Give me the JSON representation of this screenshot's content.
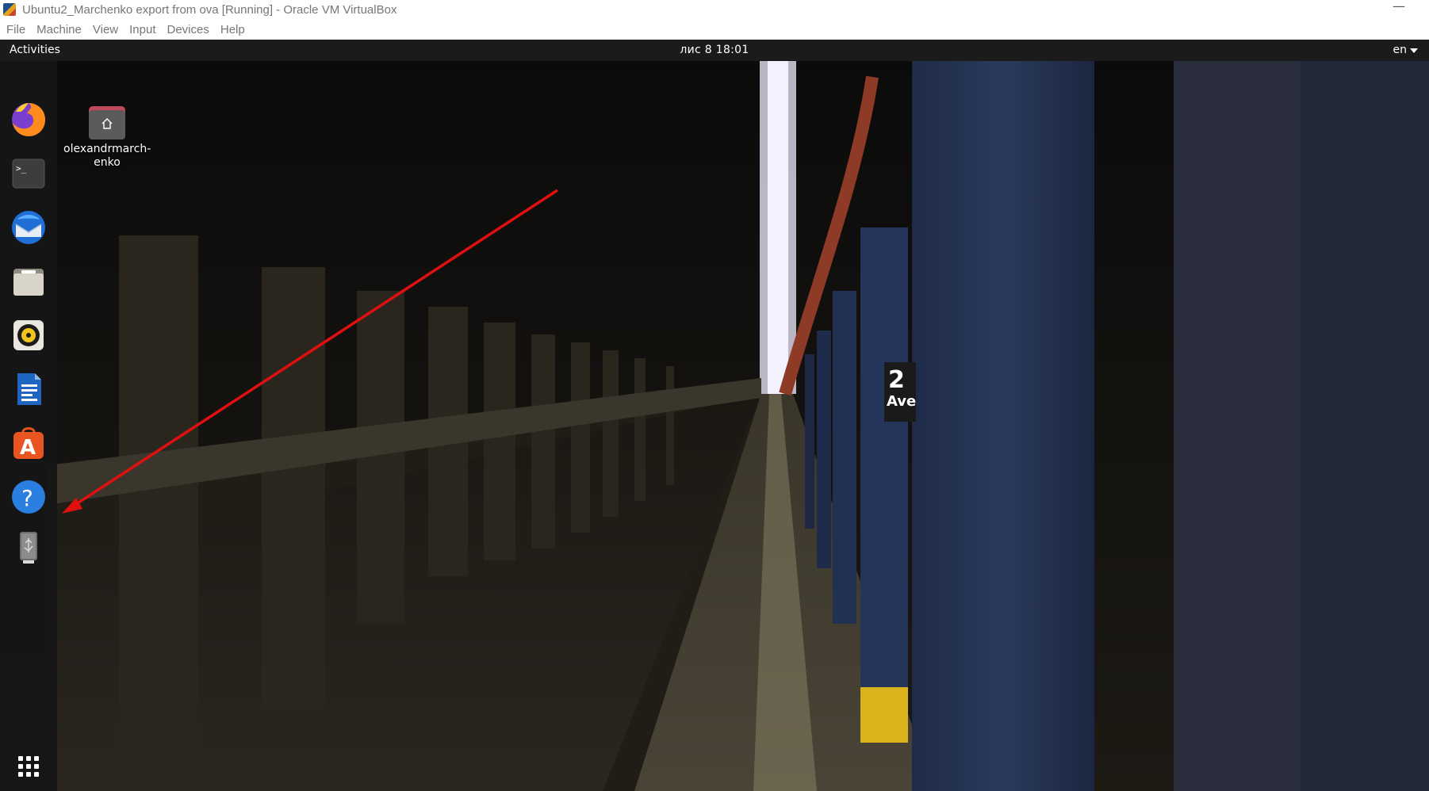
{
  "window": {
    "title": "Ubuntu2_Marchenko export from ova [Running] - Oracle VM VirtualBox",
    "minimize_glyph": "—"
  },
  "vbox_menu": [
    "File",
    "Machine",
    "View",
    "Input",
    "Devices",
    "Help"
  ],
  "top_panel": {
    "activities": "Activities",
    "clock": "лис 8  18:01",
    "language": "en"
  },
  "dock": {
    "items": [
      {
        "name": "firefox-icon"
      },
      {
        "name": "terminal-icon",
        "glyph": ">_"
      },
      {
        "name": "thunderbird-icon"
      },
      {
        "name": "files-icon"
      },
      {
        "name": "rhythmbox-icon"
      },
      {
        "name": "libreoffice-writer-icon"
      },
      {
        "name": "ubuntu-software-icon",
        "glyph": "A"
      },
      {
        "name": "help-icon",
        "glyph": "?"
      },
      {
        "name": "usb-drive-icon"
      },
      {
        "name": "show-applications-icon"
      }
    ]
  },
  "desktop": {
    "home_folder_label": "olexandrmarch-enko"
  },
  "annotation": {
    "arrow_color": "#e01010"
  }
}
